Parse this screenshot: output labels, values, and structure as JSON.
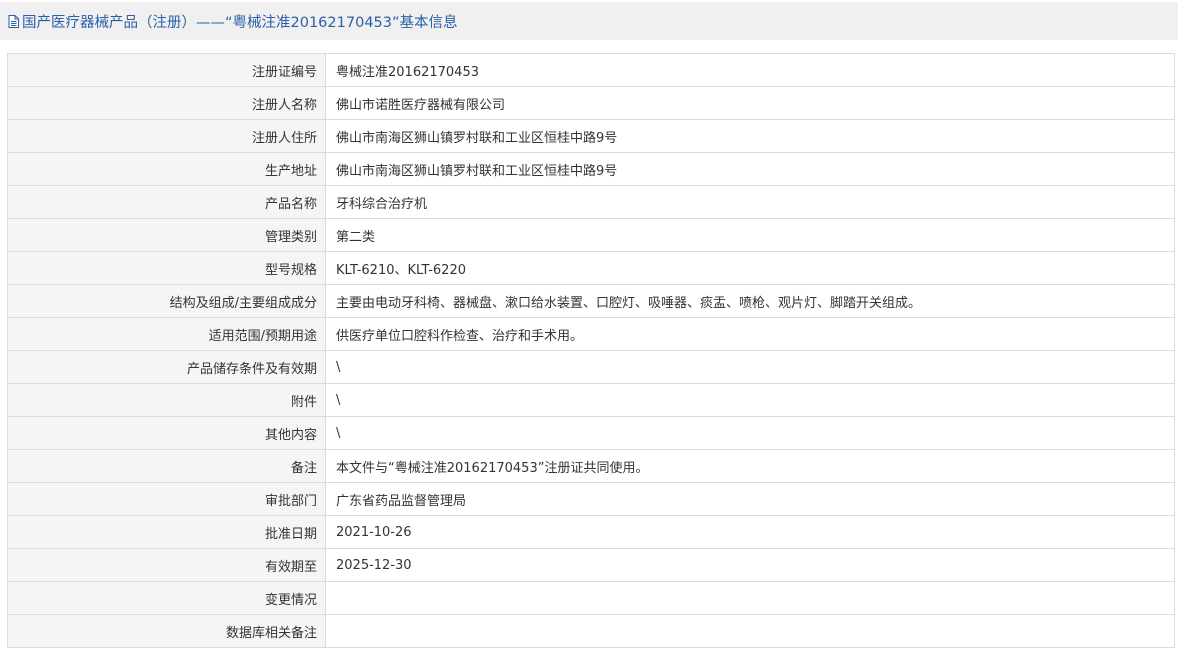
{
  "header": {
    "title": "国产医疗器械产品（注册）——“粤械注准20162170453”基本信息",
    "icon": "document-icon"
  },
  "colors": {
    "title_text": "#2a5fa8",
    "header_bg": "#f0f0f0",
    "label_bg": "#f5f5f5",
    "border": "#dcdcdc"
  },
  "rows": [
    {
      "label": "注册证编号",
      "value": "粤械注准20162170453"
    },
    {
      "label": "注册人名称",
      "value": "佛山市诺胜医疗器械有限公司"
    },
    {
      "label": "注册人住所",
      "value": "佛山市南海区狮山镇罗村联和工业区恒桂中路9号"
    },
    {
      "label": "生产地址",
      "value": "佛山市南海区狮山镇罗村联和工业区恒桂中路9号"
    },
    {
      "label": "产品名称",
      "value": "牙科综合治疗机"
    },
    {
      "label": "管理类别",
      "value": "第二类"
    },
    {
      "label": "型号规格",
      "value": "KLT-6210、KLT-6220"
    },
    {
      "label": "结构及组成/主要组成成分",
      "value": "主要由电动牙科椅、器械盘、漱口给水装置、口腔灯、吸唾器、痰盂、喷枪、观片灯、脚踏开关组成。"
    },
    {
      "label": "适用范围/预期用途",
      "value": "供医疗单位口腔科作检查、治疗和手术用。"
    },
    {
      "label": "产品储存条件及有效期",
      "value": "\\"
    },
    {
      "label": "附件",
      "value": "\\"
    },
    {
      "label": "其他内容",
      "value": "\\"
    },
    {
      "label": "备注",
      "value": "本文件与“粤械注准20162170453”注册证共同使用。"
    },
    {
      "label": "审批部门",
      "value": "广东省药品监督管理局"
    },
    {
      "label": "批准日期",
      "value": "2021-10-26"
    },
    {
      "label": "有效期至",
      "value": "2025-12-30"
    },
    {
      "label": "变更情况",
      "value": ""
    },
    {
      "label": "数据库相关备注",
      "value": ""
    }
  ]
}
